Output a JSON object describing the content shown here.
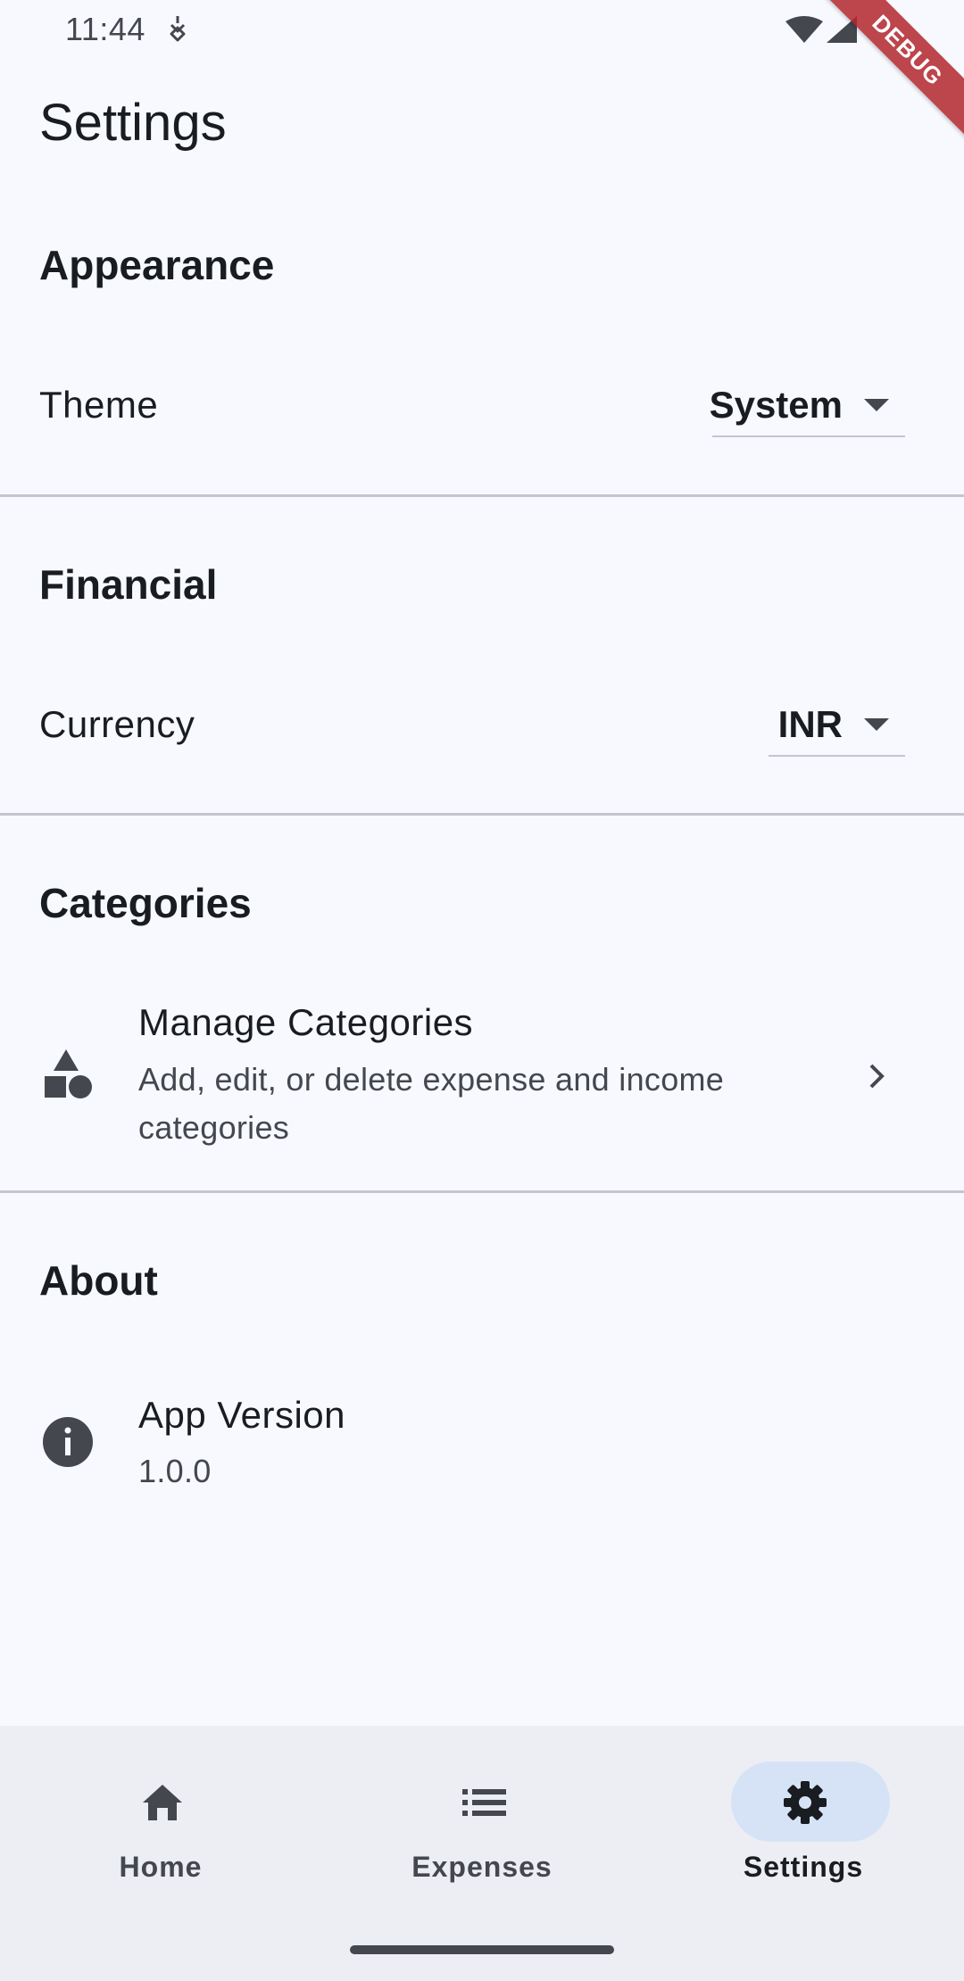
{
  "status_bar": {
    "time": "11:44",
    "debug_label": "DEBUG"
  },
  "page": {
    "title": "Settings"
  },
  "sections": {
    "appearance": {
      "title": "Appearance",
      "theme_label": "Theme",
      "theme_value": "System"
    },
    "financial": {
      "title": "Financial",
      "currency_label": "Currency",
      "currency_value": "INR"
    },
    "categories": {
      "title": "Categories",
      "manage_title": "Manage Categories",
      "manage_subtitle": "Add, edit, or delete expense and income categories"
    },
    "about": {
      "title": "About",
      "version_title": "App Version",
      "version_value": "1.0.0"
    }
  },
  "bottom_nav": {
    "items": [
      {
        "label": "Home",
        "icon": "home-icon",
        "active": false
      },
      {
        "label": "Expenses",
        "icon": "list-icon",
        "active": false
      },
      {
        "label": "Settings",
        "icon": "gear-icon",
        "active": true
      }
    ]
  },
  "colors": {
    "background": "#f7f9ff",
    "nav_background": "#edeef4",
    "active_pill": "#d6e3f7",
    "divider": "#c4c6cf",
    "debug_banner": "#b3262d"
  }
}
